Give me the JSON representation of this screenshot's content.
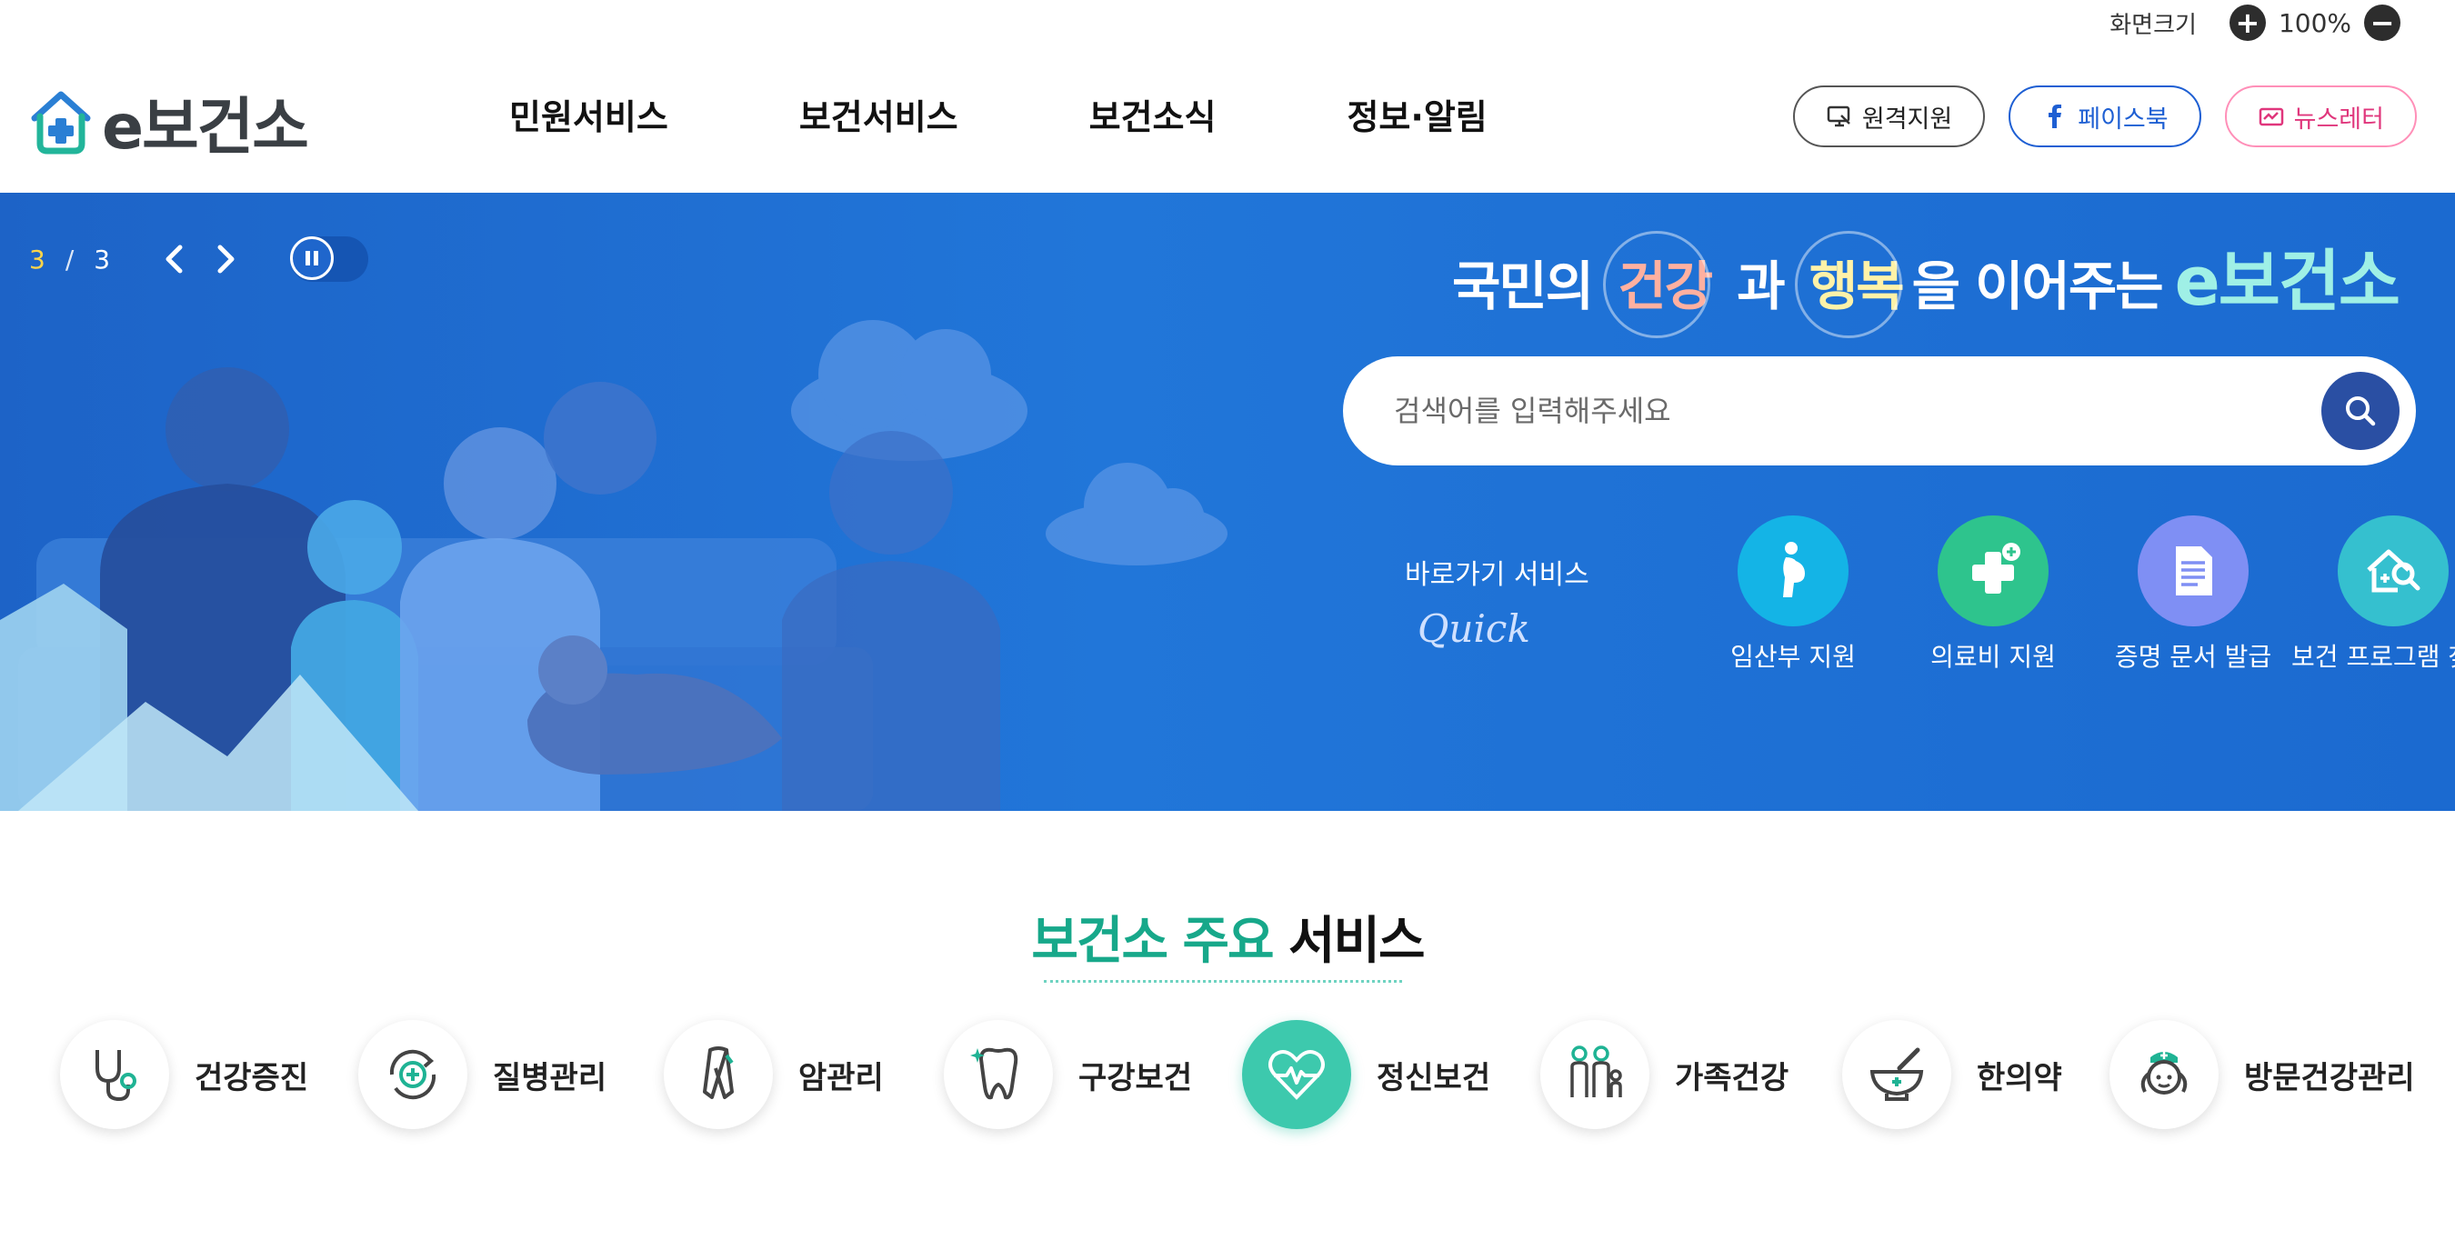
{
  "utility": {
    "screen_size_label": "화면크기",
    "zoom_in": "+",
    "zoom_level": "100%",
    "zoom_out": "−"
  },
  "header": {
    "logo_e": "e",
    "logo_text": "보건소",
    "nav": [
      "민원서비스",
      "보건서비스",
      "보건소식",
      "정보·알림"
    ],
    "buttons": {
      "remote": "원격지원",
      "facebook": "페이스북",
      "newsletter": "뉴스레터"
    }
  },
  "hero": {
    "slide_current": "3",
    "slide_sep": "/",
    "slide_total": "3",
    "tagline": {
      "part1": "국민의",
      "health": "건강",
      "part2": "과",
      "happy": "행복",
      "part3": "을 이어주는",
      "brand": "e보건소"
    },
    "search_placeholder": "검색어를 입력해주세요",
    "quick": {
      "label": "바로가기 서비스",
      "script": "Quick",
      "items": [
        {
          "label": "임산부 지원",
          "icon": "pregnant-icon",
          "color": "#14b4e6"
        },
        {
          "label": "의료비 지원",
          "icon": "medical-plus-icon",
          "color": "#2ec48d"
        },
        {
          "label": "증명 문서 발급",
          "icon": "document-icon",
          "color": "#7f8ff4"
        },
        {
          "label": "보건 프로그램 찾기",
          "icon": "home-search-icon",
          "color": "#35c0cf"
        }
      ]
    }
  },
  "services": {
    "title_green": "보건소 주요",
    "title_dark": "서비스",
    "items": [
      {
        "label": "건강증진",
        "icon": "stethoscope-icon"
      },
      {
        "label": "질병관리",
        "icon": "cycle-plus-icon"
      },
      {
        "label": "암관리",
        "icon": "ribbon-icon"
      },
      {
        "label": "구강보건",
        "icon": "tooth-icon"
      },
      {
        "label": "정신보건",
        "icon": "heart-pulse-icon",
        "active": true
      },
      {
        "label": "가족건강",
        "icon": "family-icon"
      },
      {
        "label": "한의약",
        "icon": "mortar-icon"
      },
      {
        "label": "방문건강관리",
        "icon": "nurse-icon"
      }
    ]
  },
  "colors": {
    "primary_blue": "#1d63c7",
    "accent_green": "#17a88a",
    "active_teal": "#3dc9ad"
  }
}
